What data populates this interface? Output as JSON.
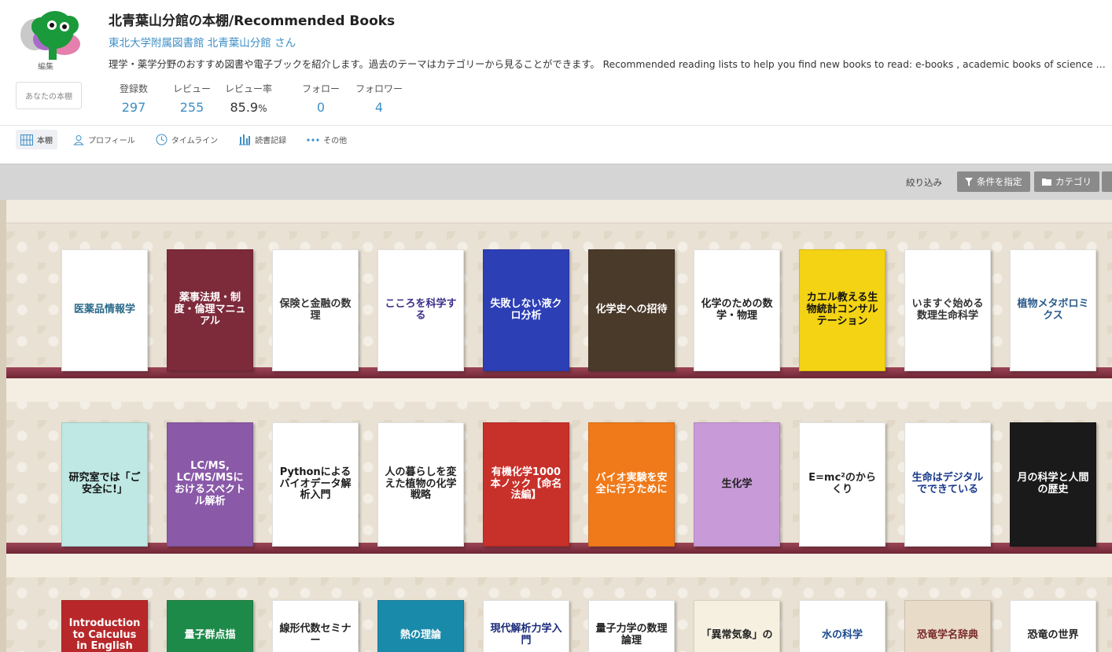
{
  "header": {
    "title": "北青葉山分館の本棚/Recommended Books",
    "owner": "東北大学附属図書館 北青葉山分館 さん",
    "description": "理学・薬学分野のおすすめ図書や電子ブックを紹介します。過去のテーマはカテゴリーから見ることができます。 Recommended reading lists to help you find new books to read: e-books , academic books of science and pha…",
    "edit_label": "編集",
    "your_shelf_label": "あなたの本棚"
  },
  "stats": {
    "registered": {
      "label": "登録数",
      "value": "297"
    },
    "reviews": {
      "label": "レビュー",
      "value": "255"
    },
    "review_rate": {
      "label": "レビュー率",
      "value": "85.9",
      "unit": "%"
    },
    "follow": {
      "label": "フォロー",
      "value": "0"
    },
    "followers": {
      "label": "フォロワー",
      "value": "4"
    }
  },
  "tabs": [
    {
      "label": "本棚",
      "icon": "bookshelf-icon"
    },
    {
      "label": "プロフィール",
      "icon": "user-icon"
    },
    {
      "label": "タイムライン",
      "icon": "clock-icon"
    },
    {
      "label": "読書記録",
      "icon": "bar-chart-icon"
    },
    {
      "label": "その他",
      "icon": "more-icon"
    }
  ],
  "filter": {
    "label": "絞り込み",
    "condition_button": "条件を指定",
    "category_button": "カテゴリ"
  },
  "shelf_rows": [
    [
      {
        "title": "医薬品情報学",
        "bg": "#ffffff",
        "fg": "#2b6a8a"
      },
      {
        "title": "薬事法規・制度・倫理マニュアル",
        "bg": "#7d2a3a",
        "fg": "#ffffff"
      },
      {
        "title": "保険と金融の数理",
        "bg": "#ffffff",
        "fg": "#333333"
      },
      {
        "title": "こころを科学する",
        "bg": "#ffffff",
        "fg": "#3a2e8a"
      },
      {
        "title": "失敗しない液クロ分析",
        "bg": "#2d3fb5",
        "fg": "#ffffff"
      },
      {
        "title": "化学史への招待",
        "bg": "#4a3a2a",
        "fg": "#ffffff"
      },
      {
        "title": "化学のための数学・物理",
        "bg": "#ffffff",
        "fg": "#222222"
      },
      {
        "title": "カエル教える生物統計コンサルテーション",
        "bg": "#f3d313",
        "fg": "#111111"
      },
      {
        "title": "いますぐ始める数理生命科学",
        "bg": "#ffffff",
        "fg": "#333333"
      },
      {
        "title": "植物メタボロミクス",
        "bg": "#ffffff",
        "fg": "#2a5a8a"
      }
    ],
    [
      {
        "title": "研究室では「ご安全に!」",
        "bg": "#bfe8e4",
        "fg": "#111111"
      },
      {
        "title": "LC/MS, LC/MS/MSにおけるスペクトル解析",
        "bg": "#8a5aa8",
        "fg": "#ffffff"
      },
      {
        "title": "Pythonによるバイオデータ解析入門",
        "bg": "#ffffff",
        "fg": "#1a1a1a"
      },
      {
        "title": "人の暮らしを変えた植物の化学戦略",
        "bg": "#ffffff",
        "fg": "#222222"
      },
      {
        "title": "有機化学1000本ノック【命名法編】",
        "bg": "#c8302a",
        "fg": "#ffffff"
      },
      {
        "title": "バイオ実験を安全に行うために",
        "bg": "#f07a1a",
        "fg": "#ffffff"
      },
      {
        "title": "生化学",
        "bg": "#c99ad8",
        "fg": "#222222"
      },
      {
        "title": "E=mc²のからくり",
        "bg": "#ffffff",
        "fg": "#222222"
      },
      {
        "title": "生命はデジタルでできている",
        "bg": "#ffffff",
        "fg": "#1a3a8a"
      },
      {
        "title": "月の科学と人間の歴史",
        "bg": "#1a1a1a",
        "fg": "#ffffff"
      }
    ],
    [
      {
        "title": "Introduction to Calculus in English",
        "bg": "#b8282a",
        "fg": "#ffffff"
      },
      {
        "title": "量子群点描",
        "bg": "#1e8a4a",
        "fg": "#ffffff"
      },
      {
        "title": "線形代数セミナー",
        "bg": "#ffffff",
        "fg": "#222222"
      },
      {
        "title": "熱の理論",
        "bg": "#1a8aaa",
        "fg": "#ffffff"
      },
      {
        "title": "現代解析力学入門",
        "bg": "#ffffff",
        "fg": "#1a2a7a"
      },
      {
        "title": "量子力学の数理論理",
        "bg": "#ffffff",
        "fg": "#222222"
      },
      {
        "title": "「異常気象」の",
        "bg": "#f5f0e0",
        "fg": "#222222"
      },
      {
        "title": "水の科学",
        "bg": "#ffffff",
        "fg": "#1a4a8a"
      },
      {
        "title": "恐竜学名辞典",
        "bg": "#e8dcc8",
        "fg": "#7a2a2a"
      },
      {
        "title": "恐竜の世界",
        "bg": "#ffffff",
        "fg": "#222222"
      }
    ]
  ]
}
